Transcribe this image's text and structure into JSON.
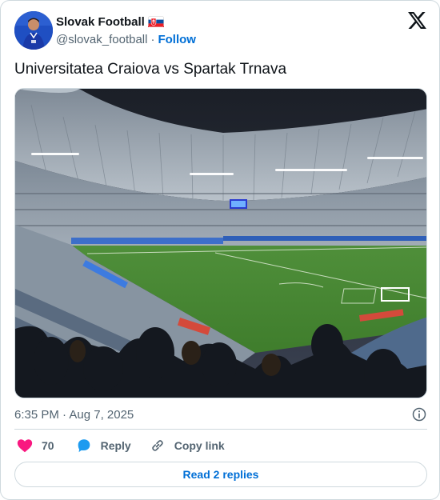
{
  "author": {
    "name": "Slovak Football",
    "handle": "@slovak_football",
    "follow_label": "Follow",
    "separator": "·",
    "flag_icon": "slovakia-flag-icon"
  },
  "tweet": {
    "text": "Universitatea Craiova vs Spartak Trnava",
    "timestamp": "6:35 PM · Aug 7, 2025"
  },
  "actions": {
    "likes_count": "70",
    "reply_label": "Reply",
    "copy_link_label": "Copy link"
  },
  "footer": {
    "read_replies_label": "Read 2 replies"
  },
  "colors": {
    "accent": "#006fd6",
    "heart": "#f91880",
    "reply_icon": "#1d9bf0",
    "muted": "#536471",
    "border": "#cfd9de"
  }
}
